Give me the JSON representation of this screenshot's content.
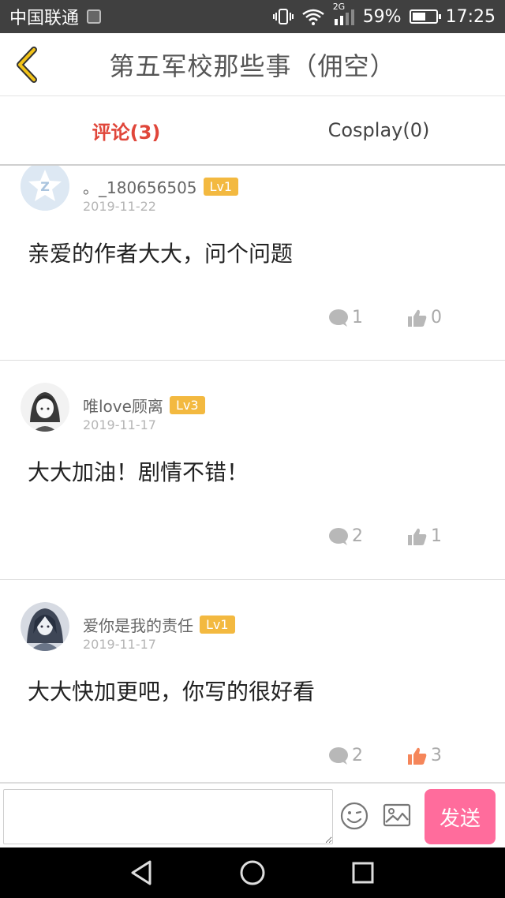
{
  "statusbar": {
    "carrier": "中国联通",
    "network": "2G",
    "battery": "59%",
    "battery_level": 0.59,
    "time": "17:25"
  },
  "header": {
    "title": "第五军校那些事（佣空）"
  },
  "tabs": [
    {
      "label": "评论(3)",
      "active": true
    },
    {
      "label": "Cosplay(0)",
      "active": false
    }
  ],
  "comments": [
    {
      "username": "。_180656505",
      "level": "Lv1",
      "date": "2019-11-22",
      "content": "亲爱的作者大大，问个问题",
      "reply_count": "1",
      "like_count": "0",
      "liked": false,
      "avatar": "default-avatar-icon"
    },
    {
      "username": "唯love顾离",
      "level": "Lv3",
      "date": "2019-11-17",
      "content": "大大加油！剧情不错！",
      "reply_count": "2",
      "like_count": "1",
      "liked": false,
      "avatar": "anime-girl-avatar"
    },
    {
      "username": "爱你是我的责任",
      "level": "Lv1",
      "date": "2019-11-17",
      "content": "大大快加更吧，你写的很好看",
      "reply_count": "2",
      "like_count": "3",
      "liked": true,
      "avatar": "anime-character-avatar"
    }
  ],
  "composer": {
    "placeholder": "",
    "send_label": "发送"
  },
  "colors": {
    "accent_red": "#e0463a",
    "level_badge": "#f3b940",
    "send_button": "#ff6c9c",
    "liked": "#f5865a"
  }
}
